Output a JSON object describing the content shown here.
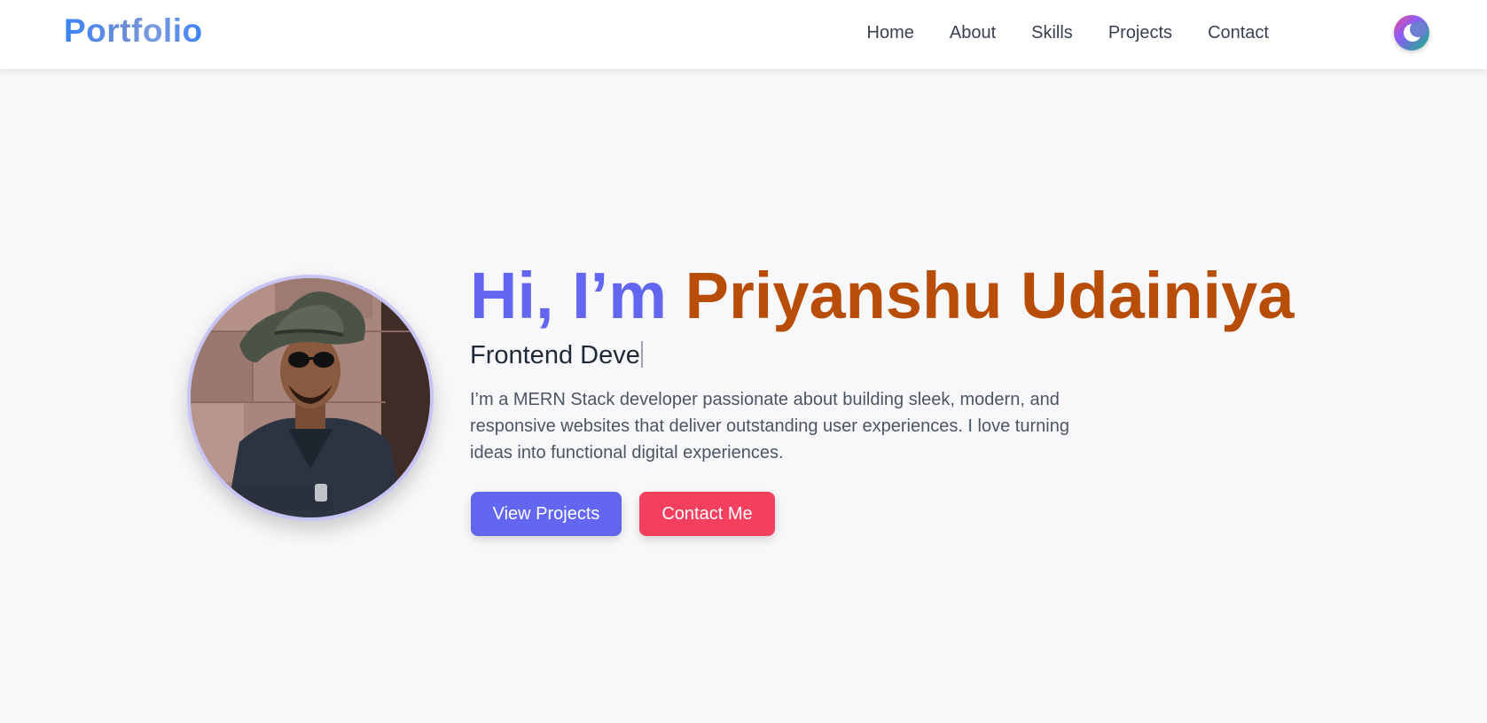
{
  "header": {
    "logo": "Portfolio",
    "nav": [
      {
        "label": "Home"
      },
      {
        "label": "About"
      },
      {
        "label": "Skills"
      },
      {
        "label": "Projects"
      },
      {
        "label": "Contact"
      }
    ],
    "theme_toggle_icon": "moon-icon"
  },
  "hero": {
    "greeting": "Hi, I’m ",
    "name": "Priyanshu Udainiya",
    "typed_role": "Frontend Deve",
    "intro": "I’m a MERN Stack developer passionate about building sleek, modern, and responsive websites that deliver outstanding user experiences. I love turning ideas into functional digital experiences.",
    "buttons": {
      "view_projects": "View Projects",
      "contact_me": "Contact Me"
    }
  },
  "colors": {
    "accent_indigo": "#6366f1",
    "name_orange": "#b84d07",
    "contact_red": "#f43f5e",
    "page_bg": "#f8f8fa"
  }
}
